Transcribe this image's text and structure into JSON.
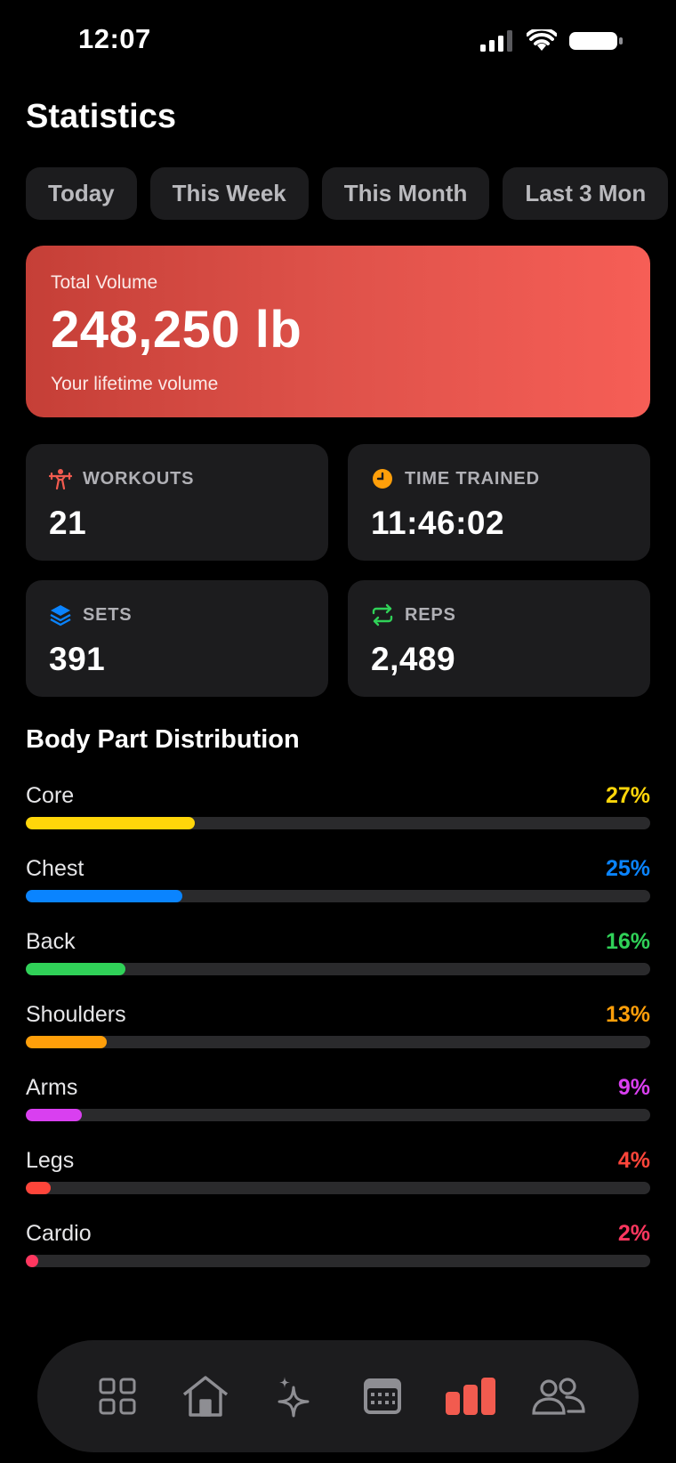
{
  "status_bar": {
    "time": "12:07"
  },
  "page": {
    "title": "Statistics"
  },
  "periods": [
    "Today",
    "This Week",
    "This Month",
    "Last 3 Mon"
  ],
  "hero": {
    "label": "Total Volume",
    "value": "248,250 lb",
    "subtitle": "Your lifetime volume",
    "colors": {
      "start": "#c53f37",
      "end": "#f65e56"
    }
  },
  "stats": {
    "workouts": {
      "label": "WORKOUTS",
      "value": "21",
      "icon": "weightlifter-icon",
      "color": "#f25b4f"
    },
    "time": {
      "label": "TIME TRAINED",
      "value": "11:46:02",
      "icon": "clock-icon",
      "color": "#ff9f0a"
    },
    "sets": {
      "label": "SETS",
      "value": "391",
      "icon": "layers-icon",
      "color": "#0a84ff"
    },
    "reps": {
      "label": "REPS",
      "value": "2,489",
      "icon": "repeat-icon",
      "color": "#30d158"
    }
  },
  "distribution": {
    "title": "Body Part Distribution",
    "items": [
      {
        "name": "Core",
        "percent_label": "27%",
        "fraction": 0.27,
        "color": "#ffd60a"
      },
      {
        "name": "Chest",
        "percent_label": "25%",
        "fraction": 0.25,
        "color": "#0a84ff"
      },
      {
        "name": "Back",
        "percent_label": "16%",
        "fraction": 0.16,
        "color": "#30d158"
      },
      {
        "name": "Shoulders",
        "percent_label": "13%",
        "fraction": 0.13,
        "color": "#ff9f0a"
      },
      {
        "name": "Arms",
        "percent_label": "9%",
        "fraction": 0.09,
        "color": "#d93ff0"
      },
      {
        "name": "Legs",
        "percent_label": "4%",
        "fraction": 0.04,
        "color": "#ff453a"
      },
      {
        "name": "Cardio",
        "percent_label": "2%",
        "fraction": 0.02,
        "color": "#ff375f"
      }
    ]
  },
  "tabbar": {
    "items": [
      "grid-icon",
      "home-icon",
      "sparkles-icon",
      "calendar-icon",
      "chart-bars-icon",
      "people-icon"
    ],
    "active_color": "#f25b4f",
    "inactive_color": "#8e8e93"
  }
}
